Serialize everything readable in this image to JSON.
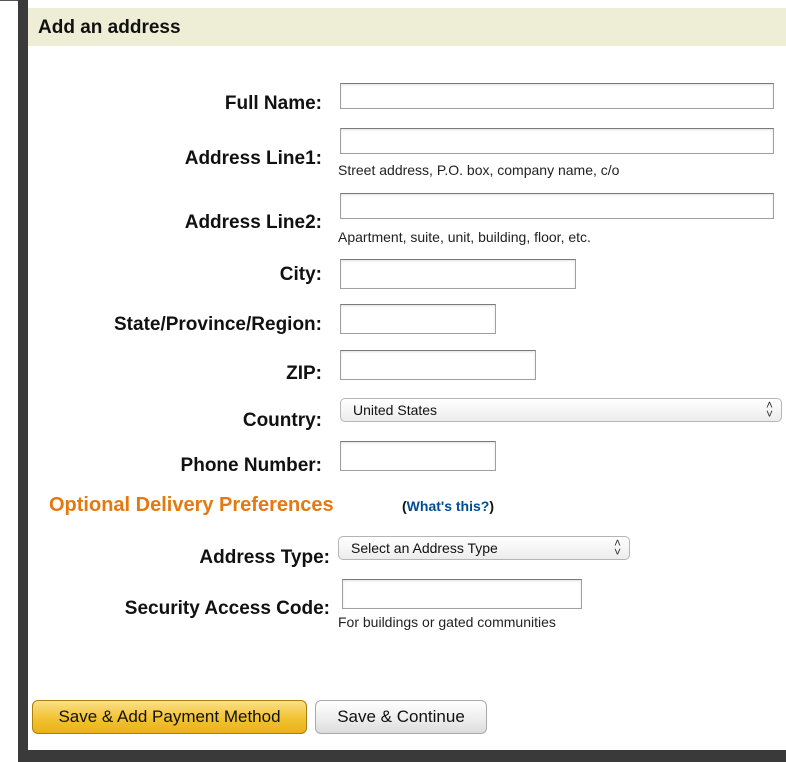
{
  "header": {
    "title": "Add an address"
  },
  "fields": {
    "full_name": {
      "label": "Full Name:",
      "value": ""
    },
    "address_line1": {
      "label": "Address Line1:",
      "value": "",
      "hint": "Street address, P.O. box, company name, c/o"
    },
    "address_line2": {
      "label": "Address Line2:",
      "value": "",
      "hint": "Apartment, suite, unit, building, floor, etc."
    },
    "city": {
      "label": "City:",
      "value": ""
    },
    "state": {
      "label": "State/Province/Region:",
      "value": ""
    },
    "zip": {
      "label": "ZIP:",
      "value": ""
    },
    "country": {
      "label": "Country:",
      "selected": "United States"
    },
    "phone": {
      "label": "Phone Number:",
      "value": ""
    }
  },
  "optional": {
    "heading": "Optional Delivery Preferences",
    "whats_this_open": "(",
    "whats_this_link": "What's this?",
    "whats_this_close": ")",
    "address_type": {
      "label": "Address Type:",
      "selected": "Select an Address Type"
    },
    "security_code": {
      "label": "Security Access Code:",
      "value": "",
      "hint": "For buildings or gated communities"
    }
  },
  "buttons": {
    "primary": "Save & Add Payment Method",
    "secondary": "Save & Continue"
  },
  "icons": {
    "select_arrows": "updown-chevron-icon"
  },
  "colors": {
    "header_bg": "#eeeed6",
    "optional_heading": "#e47911",
    "link": "#004b91",
    "primary_button": "#f2c232"
  }
}
